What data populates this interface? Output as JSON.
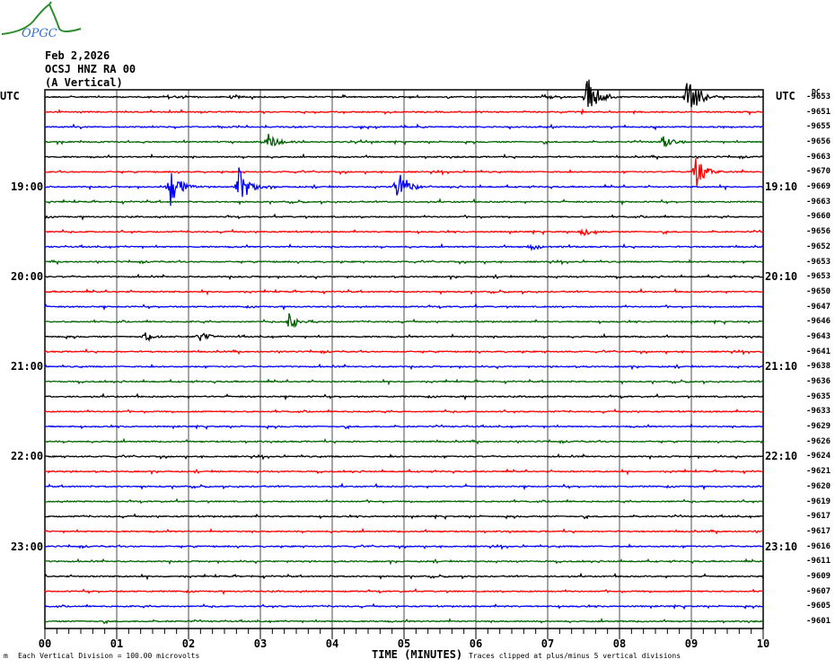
{
  "logo_text": "OPGC",
  "header": {
    "date": "Feb 2,2026",
    "station": "OCSJ HNZ RA 00",
    "component": "(A Vertical)"
  },
  "left_axis": {
    "title": "UTC",
    "labels": [
      {
        "row": 6,
        "text": "19:00"
      },
      {
        "row": 12,
        "text": "20:00"
      },
      {
        "row": 18,
        "text": "21:00"
      },
      {
        "row": 24,
        "text": "22:00"
      },
      {
        "row": 30,
        "text": "23:00"
      }
    ]
  },
  "right_axis": {
    "title": "UTC",
    "dc_label": "DC",
    "labels": [
      {
        "row": 6,
        "text": "19:10"
      },
      {
        "row": 12,
        "text": "20:10"
      },
      {
        "row": 18,
        "text": "21:10"
      },
      {
        "row": 24,
        "text": "22:10"
      },
      {
        "row": 30,
        "text": "23:10"
      }
    ]
  },
  "chart_data": {
    "type": "line",
    "xlabel": "TIME (MINUTES)",
    "xlim": [
      0,
      10
    ],
    "x_ticks": [
      "00",
      "01",
      "02",
      "03",
      "04",
      "05",
      "06",
      "07",
      "08",
      "09",
      "10"
    ],
    "trace_colors": [
      "#000000",
      "#ff0000",
      "#0000ff",
      "#006400"
    ],
    "dc_offsets": [
      "-9653",
      "-9651",
      "-9655",
      "-9656",
      "-9663",
      "-9670",
      "-9669",
      "-9663",
      "-9660",
      "-9656",
      "-9652",
      "-9653",
      "-9653",
      "-9650",
      "-9647",
      "-9646",
      "-9643",
      "-9641",
      "-9638",
      "-9636",
      "-9635",
      "-9633",
      "-9629",
      "-9626",
      "-9624",
      "-9621",
      "-9620",
      "-9619",
      "-9617",
      "-9617",
      "-9616",
      "-9611",
      "-9609",
      "-9607",
      "-9605",
      "-9601"
    ],
    "events": [
      {
        "row": 0,
        "minute": 7.55,
        "amplitude": 1.6
      },
      {
        "row": 0,
        "minute": 8.95,
        "amplitude": 1.8
      },
      {
        "row": 0,
        "minute": 1.7,
        "amplitude": 0.15
      },
      {
        "row": 0,
        "minute": 2.6,
        "amplitude": 0.15
      },
      {
        "row": 3,
        "minute": 3.1,
        "amplitude": 0.6
      },
      {
        "row": 3,
        "minute": 8.6,
        "amplitude": 0.55
      },
      {
        "row": 5,
        "minute": 9.05,
        "amplitude": 1.2
      },
      {
        "row": 6,
        "minute": 1.75,
        "amplitude": 1.4
      },
      {
        "row": 6,
        "minute": 2.7,
        "amplitude": 1.3
      },
      {
        "row": 6,
        "minute": 4.9,
        "amplitude": 1.4
      },
      {
        "row": 9,
        "minute": 7.48,
        "amplitude": 0.3
      },
      {
        "row": 10,
        "minute": 6.75,
        "amplitude": 0.25
      },
      {
        "row": 15,
        "minute": 3.4,
        "amplitude": 0.6
      },
      {
        "row": 16,
        "minute": 1.4,
        "amplitude": 0.4
      },
      {
        "row": 16,
        "minute": 2.15,
        "amplitude": 0.35
      }
    ]
  },
  "footer": {
    "scale": "Each Vertical Division =  100.00 microvolts",
    "clip": "Traces clipped at plus/minus 5 vertical divisions",
    "corner_mark": "m"
  }
}
